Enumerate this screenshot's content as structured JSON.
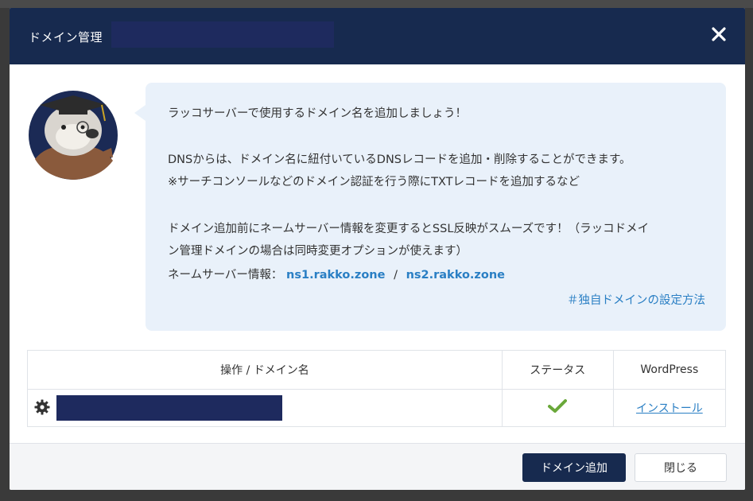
{
  "modal": {
    "title": "ドメイン管理",
    "close_icon": "close-icon"
  },
  "message": {
    "line1": "ラッコサーバーで使用するドメイン名を追加しましょう！",
    "line2": "DNSからは、ドメイン名に紐付いているDNSレコードを追加・削除することができます。",
    "line3": "※サーチコンソールなどのドメイン認証を行う際にTXTレコードを追加するなど",
    "line4": "ドメイン追加前にネームサーバー情報を変更するとSSL反映がスムーズです！（ラッコドメイ",
    "line5": "ン管理ドメインの場合は同時変更オプションが使えます）",
    "ns_label": "ネームサーバー情報：",
    "ns1": "ns1.rakko.zone",
    "ns_separator": "/",
    "ns2": "ns2.rakko.zone",
    "help_link": "＃独自ドメインの設定方法"
  },
  "table": {
    "headers": {
      "operation": "操作 / ドメイン名",
      "status": "ステータス",
      "wordpress": "WordPress"
    },
    "rows": [
      {
        "status_icon": "check-icon",
        "wordpress_action": "インストール"
      }
    ]
  },
  "footer": {
    "add_button": "ドメイン追加",
    "close_button": "閉じる"
  },
  "colors": {
    "header_bg": "#172a4f",
    "bubble_bg": "#e9f1fa",
    "link": "#2a7fc4",
    "check": "#6aa83a"
  }
}
